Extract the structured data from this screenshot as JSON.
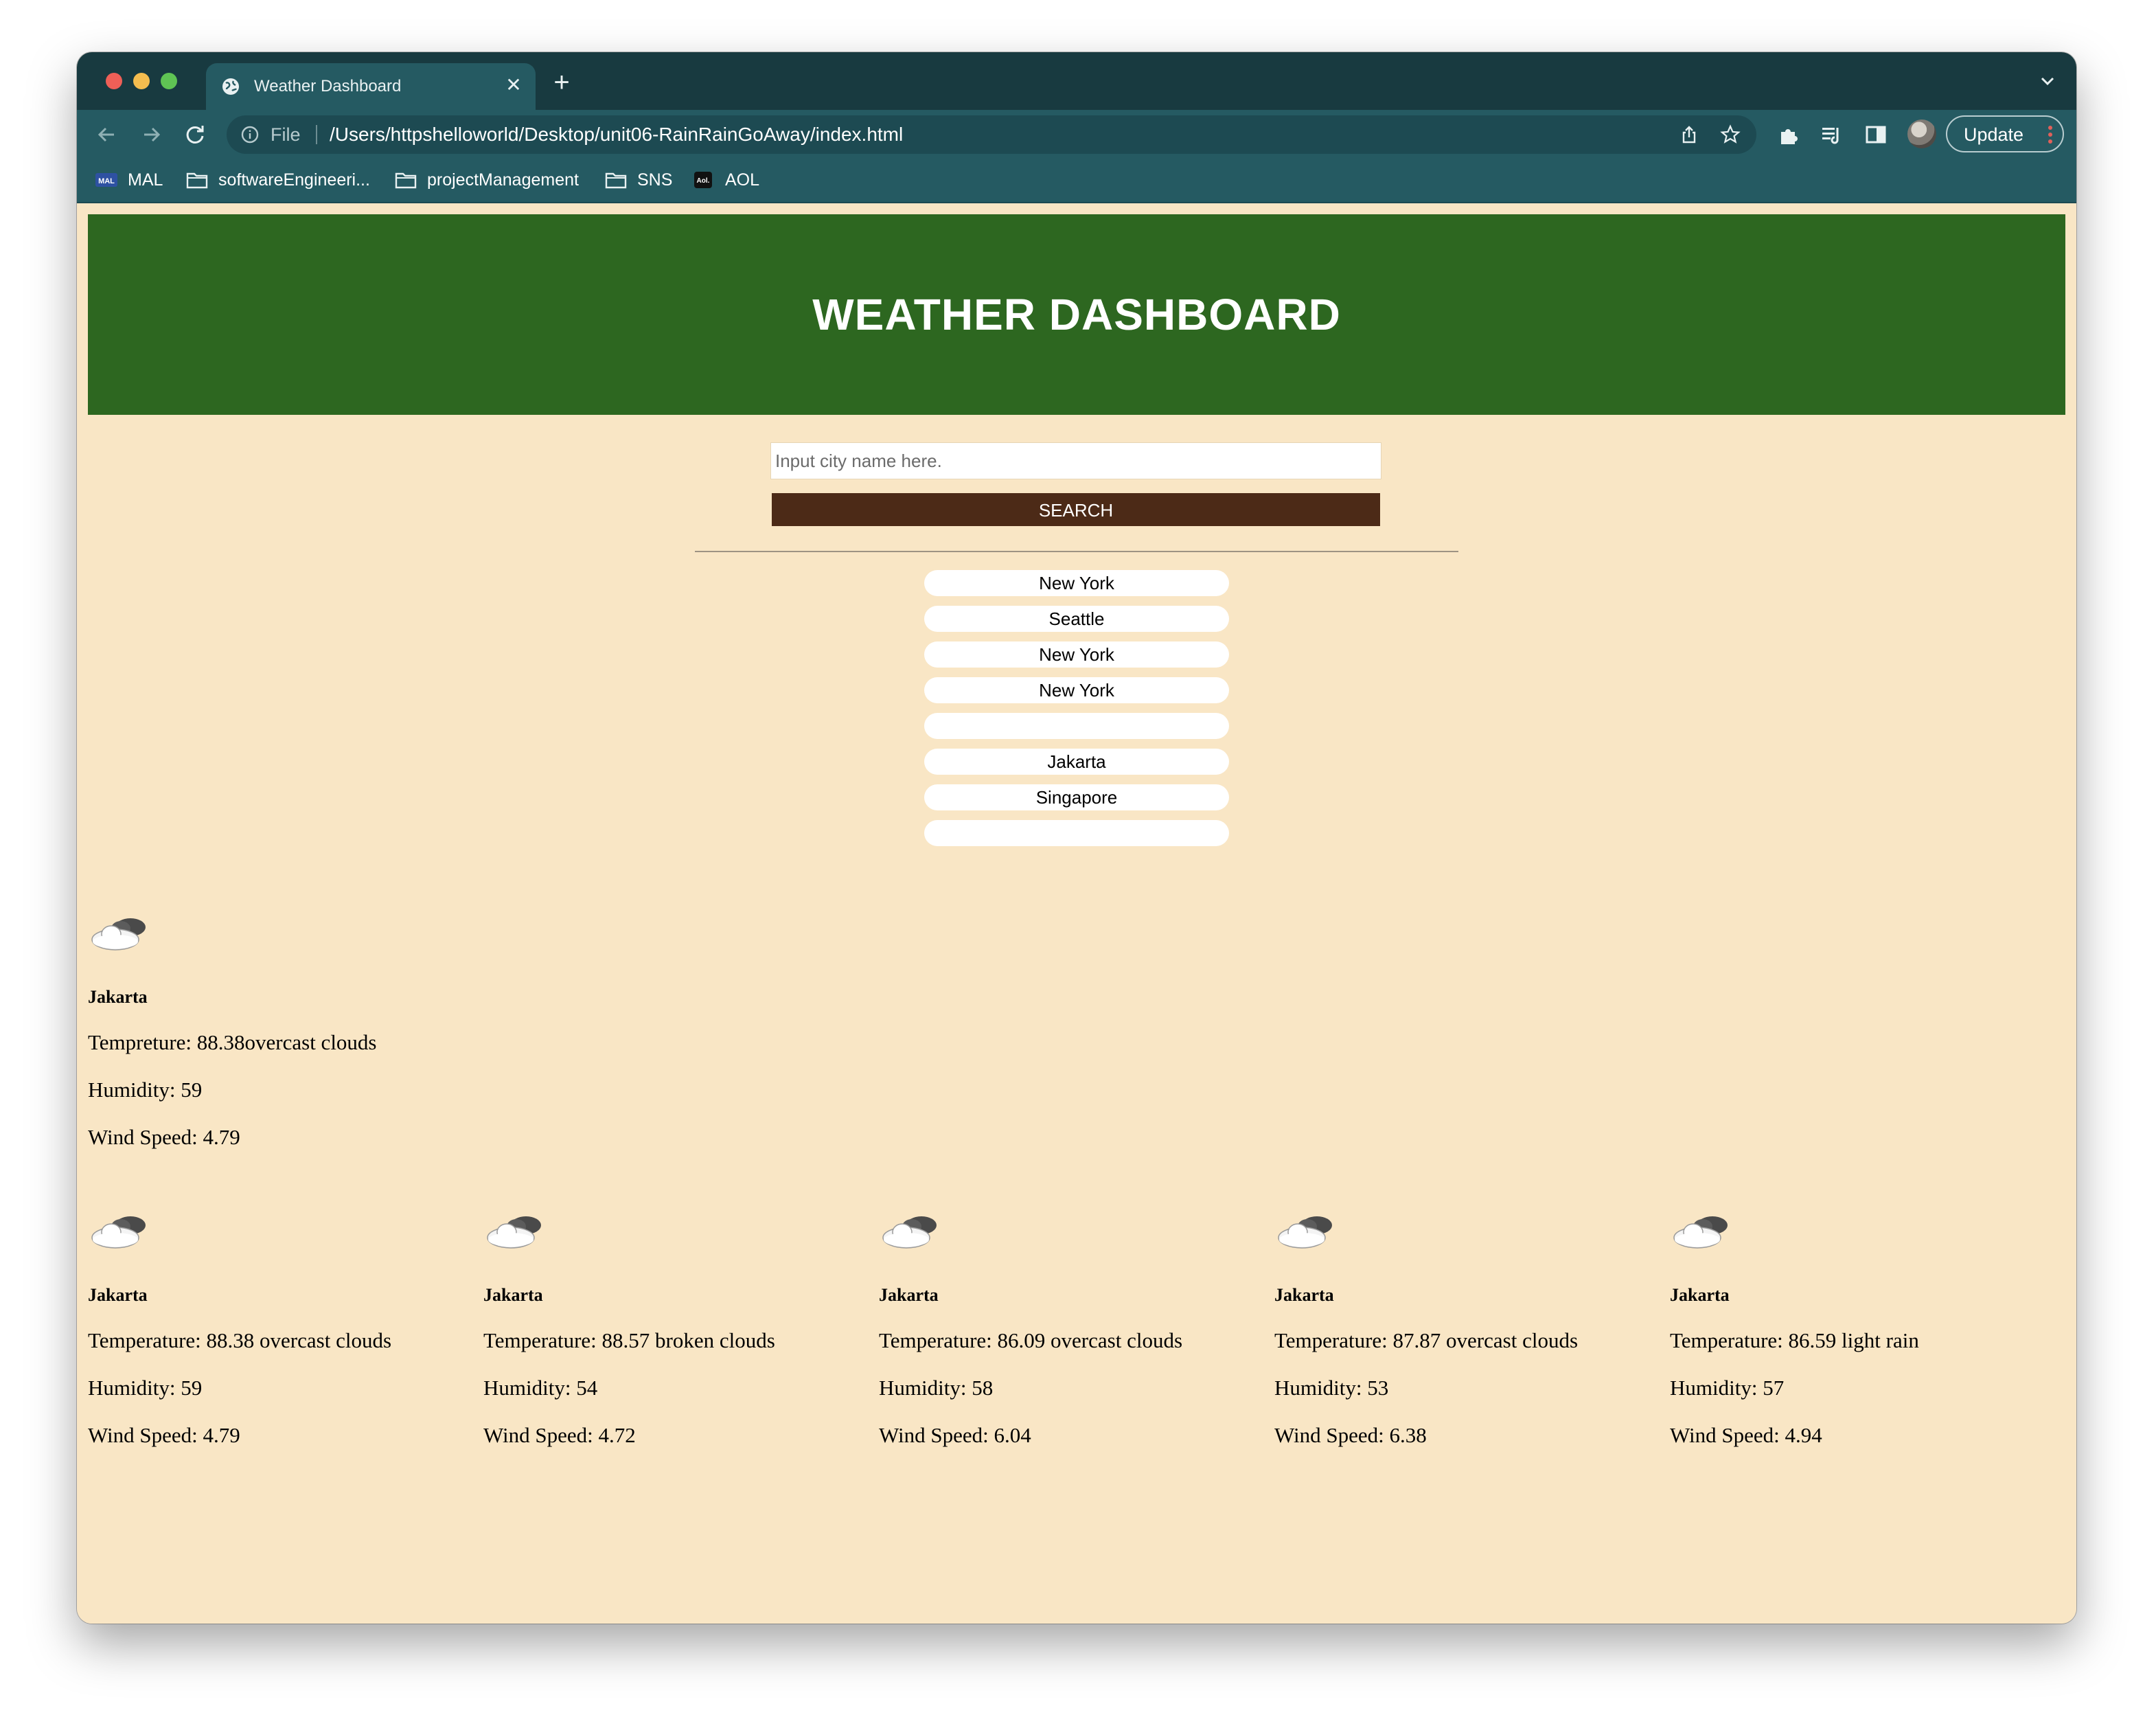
{
  "browser": {
    "tab_title": "Weather Dashboard",
    "address_prefix": "File",
    "url": "/Users/httpshelloworld/Desktop/unit06-RainRainGoAway/index.html",
    "update_label": "Update",
    "bookmarks": [
      {
        "label": "MAL",
        "icon": "mal-icon"
      },
      {
        "label": "softwareEngineeri...",
        "icon": "folder-icon"
      },
      {
        "label": "projectManagement",
        "icon": "folder-icon"
      },
      {
        "label": "SNS",
        "icon": "folder-icon"
      },
      {
        "label": "AOL",
        "icon": "aol-icon"
      }
    ]
  },
  "header": {
    "title": "WEATHER DASHBOARD"
  },
  "search": {
    "placeholder": "Input city name here.",
    "value": "",
    "button_label": "SEARCH"
  },
  "history": [
    "New York",
    "Seattle",
    "New York",
    "New York",
    "",
    "Jakarta",
    "Singapore",
    ""
  ],
  "current": {
    "icon": "cloud-icon",
    "city": "Jakarta",
    "temperature_line": "Tempreture: 88.38overcast clouds",
    "humidity_line": "Humidity: 59",
    "wind_line": "Wind Speed: 4.79"
  },
  "forecast": [
    {
      "city": "Jakarta",
      "temperature_line": "Temperature: 88.38 overcast clouds",
      "humidity_line": "Humidity: 59",
      "wind_line": "Wind Speed: 4.79"
    },
    {
      "city": "Jakarta",
      "temperature_line": "Temperature: 88.57 broken clouds",
      "humidity_line": "Humidity: 54",
      "wind_line": "Wind Speed: 4.72"
    },
    {
      "city": "Jakarta",
      "temperature_line": "Temperature: 86.09 overcast clouds",
      "humidity_line": "Humidity: 58",
      "wind_line": "Wind Speed: 6.04"
    },
    {
      "city": "Jakarta",
      "temperature_line": "Temperature: 87.87 overcast clouds",
      "humidity_line": "Humidity: 53",
      "wind_line": "Wind Speed: 6.38"
    },
    {
      "city": "Jakarta",
      "temperature_line": "Temperature: 86.59 light rain",
      "humidity_line": "Humidity: 57",
      "wind_line": "Wind Speed: 4.94"
    }
  ],
  "colors": {
    "tabbar": "#183a40",
    "toolbar": "#255a62",
    "page_background": "#f9e6c5",
    "header_background": "#2d6720",
    "search_button": "#4c2a17"
  }
}
